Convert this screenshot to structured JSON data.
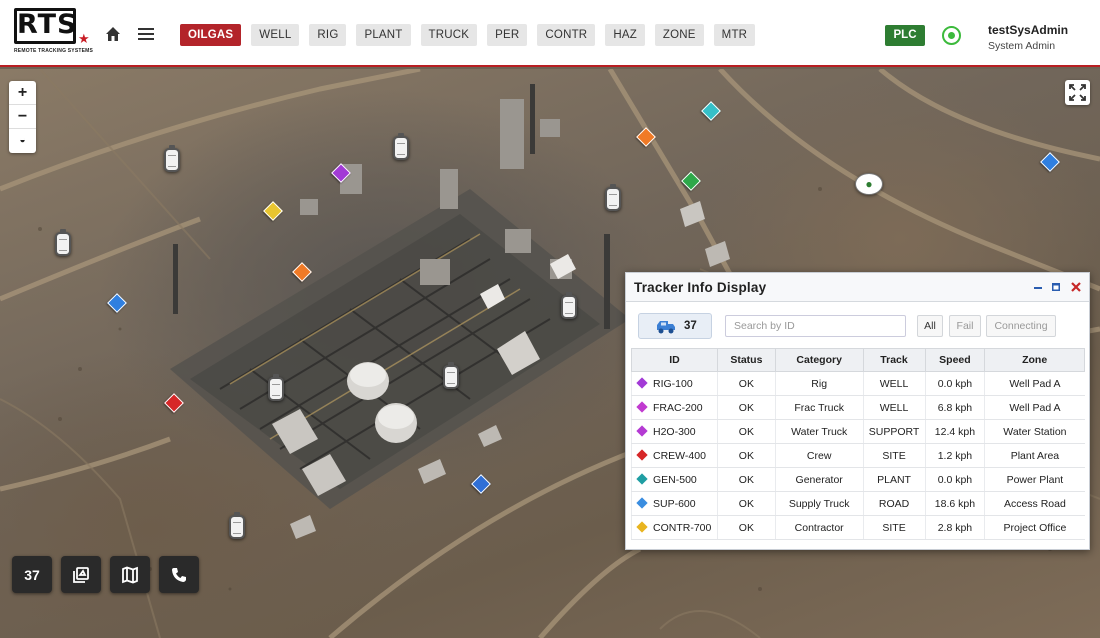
{
  "app": {
    "logo_text": "RTS",
    "logo_subtitle": "REMOTE TRACKING SYSTEMS"
  },
  "nav": {
    "items": [
      "OILGAS",
      "WELL",
      "RIG",
      "PLANT",
      "TRUCK",
      "PER",
      "CONTR",
      "HAZ",
      "ZONE",
      "MTR"
    ],
    "active": "OILGAS"
  },
  "header": {
    "plc_label": "PLC",
    "user_name": "testSysAdmin",
    "user_role": "System Admin"
  },
  "map": {
    "zoom_in": "+",
    "zoom_out": "−",
    "tracker_count": "37"
  },
  "panel": {
    "title": "Tracker Info Display",
    "count": "37",
    "search_placeholder": "Search by ID",
    "filters": [
      "All",
      "Fail",
      "Connecting"
    ],
    "columns": [
      "ID",
      "Status",
      "Category",
      "Track",
      "Speed",
      "Zone"
    ],
    "rows": [
      {
        "id": "RIG-100",
        "status": "OK",
        "category": "Rig",
        "track": "WELL",
        "speed": "0.0 kph",
        "zone": "Well Pad A",
        "color": "#a23ad6"
      },
      {
        "id": "FRAC-200",
        "status": "OK",
        "category": "Frac Truck",
        "track": "WELL",
        "speed": "6.8 kph",
        "zone": "Well Pad A",
        "color": "#c13bd0"
      },
      {
        "id": "H2O-300",
        "status": "OK",
        "category": "Water Truck",
        "track": "SUPPORT",
        "speed": "12.4 kph",
        "zone": "Water Station",
        "color": "#b43ad3"
      },
      {
        "id": "CREW-400",
        "status": "OK",
        "category": "Crew",
        "track": "SITE",
        "speed": "1.2 kph",
        "zone": "Plant Area",
        "color": "#d62728"
      },
      {
        "id": "GEN-500",
        "status": "OK",
        "category": "Generator",
        "track": "PLANT",
        "speed": "0.0 kph",
        "zone": "Power Plant",
        "color": "#1f9ea3"
      },
      {
        "id": "SUP-600",
        "status": "OK",
        "category": "Supply Truck",
        "track": "ROAD",
        "speed": "18.6 kph",
        "zone": "Access Road",
        "color": "#3a8de0"
      },
      {
        "id": "CONTR-700",
        "status": "OK",
        "category": "Contractor",
        "track": "SITE",
        "speed": "2.8 kph",
        "zone": "Project Office",
        "color": "#e8b420"
      }
    ]
  },
  "colors": {
    "brand_red": "#b3242a",
    "plc_green": "#2e7d32",
    "status_green": "#3cba3c"
  }
}
